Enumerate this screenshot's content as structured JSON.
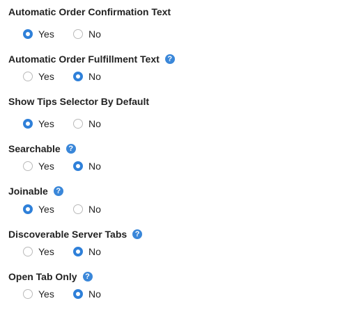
{
  "settings": [
    {
      "label": "Automatic Order Confirmation Text",
      "has_help": false,
      "yes_label": "Yes",
      "no_label": "No",
      "selected": "yes"
    },
    {
      "label": "Automatic Order Fulfillment Text",
      "has_help": true,
      "help_icon": "?",
      "yes_label": "Yes",
      "no_label": "No",
      "selected": "no"
    },
    {
      "label": "Show Tips Selector By Default",
      "has_help": false,
      "yes_label": "Yes",
      "no_label": "No",
      "selected": "yes"
    },
    {
      "label": "Searchable",
      "has_help": true,
      "help_icon": "?",
      "yes_label": "Yes",
      "no_label": "No",
      "selected": "no"
    },
    {
      "label": "Joinable",
      "has_help": true,
      "help_icon": "?",
      "yes_label": "Yes",
      "no_label": "No",
      "selected": "yes"
    },
    {
      "label": "Discoverable Server Tabs",
      "has_help": true,
      "help_icon": "?",
      "yes_label": "Yes",
      "no_label": "No",
      "selected": "no"
    },
    {
      "label": "Open Tab Only",
      "has_help": true,
      "help_icon": "?",
      "yes_label": "Yes",
      "no_label": "No",
      "selected": "no"
    }
  ],
  "colors": {
    "accent": "#2f80d9",
    "help_icon": "#3a87d9",
    "text": "#222222"
  }
}
